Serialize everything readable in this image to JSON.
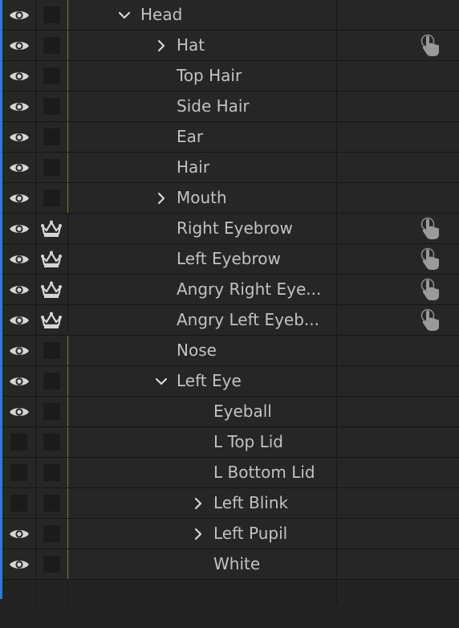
{
  "layers": [
    {
      "label": "Head",
      "depth": 0,
      "chevron": "expanded",
      "eye": true,
      "tag": "square",
      "gold": true,
      "hand": false
    },
    {
      "label": "Hat",
      "depth": 1,
      "chevron": "collapsed",
      "eye": true,
      "tag": "square",
      "gold": true,
      "hand": true
    },
    {
      "label": "Top Hair",
      "depth": 1,
      "chevron": "none",
      "eye": true,
      "tag": "square",
      "gold": true,
      "hand": false
    },
    {
      "label": "Side Hair",
      "depth": 1,
      "chevron": "none",
      "eye": true,
      "tag": "square",
      "gold": true,
      "hand": false
    },
    {
      "label": "Ear",
      "depth": 1,
      "chevron": "none",
      "eye": true,
      "tag": "square",
      "gold": true,
      "hand": false
    },
    {
      "label": "Hair",
      "depth": 1,
      "chevron": "none",
      "eye": true,
      "tag": "square",
      "gold": true,
      "hand": false
    },
    {
      "label": "Mouth",
      "depth": 1,
      "chevron": "collapsed",
      "eye": true,
      "tag": "square",
      "gold": true,
      "hand": false
    },
    {
      "label": "Right Eyebrow",
      "depth": 1,
      "chevron": "none",
      "eye": true,
      "tag": "crown",
      "gold": false,
      "hand": true
    },
    {
      "label": "Left  Eyebrow",
      "depth": 1,
      "chevron": "none",
      "eye": true,
      "tag": "crown",
      "gold": false,
      "hand": true
    },
    {
      "label": "Angry Right Eye...",
      "depth": 1,
      "chevron": "none",
      "eye": true,
      "tag": "crown",
      "gold": false,
      "hand": true
    },
    {
      "label": "Angry Left  Eyeb...",
      "depth": 1,
      "chevron": "none",
      "eye": true,
      "tag": "crown",
      "gold": false,
      "hand": true
    },
    {
      "label": "Nose",
      "depth": 1,
      "chevron": "none",
      "eye": true,
      "tag": "square",
      "gold": true,
      "hand": false
    },
    {
      "label": "Left Eye",
      "depth": 1,
      "chevron": "expanded",
      "eye": true,
      "tag": "square",
      "gold": true,
      "hand": false
    },
    {
      "label": "Eyeball",
      "depth": 2,
      "chevron": "none",
      "eye": true,
      "tag": "square",
      "gold": true,
      "hand": false
    },
    {
      "label": "L Top Lid",
      "depth": 2,
      "chevron": "none",
      "eye": false,
      "tag": "square",
      "gold": true,
      "hand": false
    },
    {
      "label": "L Bottom Lid",
      "depth": 2,
      "chevron": "none",
      "eye": false,
      "tag": "square",
      "gold": true,
      "hand": false
    },
    {
      "label": "Left Blink",
      "depth": 2,
      "chevron": "collapsed",
      "eye": false,
      "tag": "square",
      "gold": true,
      "hand": false
    },
    {
      "label": "Left Pupil",
      "depth": 2,
      "chevron": "collapsed",
      "eye": true,
      "tag": "square",
      "gold": true,
      "hand": false
    },
    {
      "label": "White",
      "depth": 2,
      "chevron": "none",
      "eye": true,
      "tag": "square",
      "gold": true,
      "hand": false
    }
  ],
  "colors": {
    "selection_accent": "#2b7bd6",
    "tag_gold": "#8d7b1d",
    "text": "#c2c2c2",
    "icon": "#d6d6d6"
  }
}
